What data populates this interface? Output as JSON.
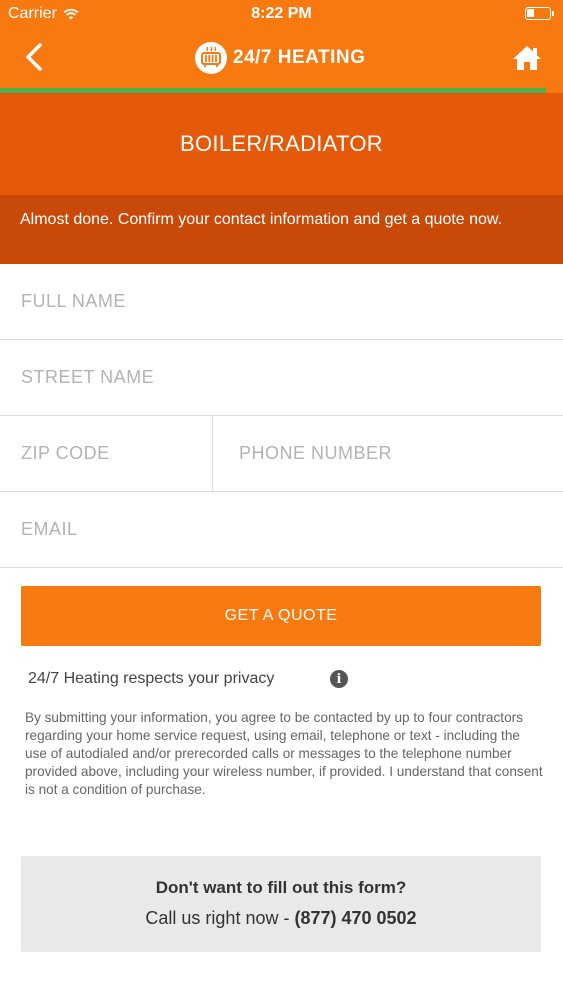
{
  "status_bar": {
    "carrier": "Carrier",
    "time": "8:22 PM"
  },
  "nav": {
    "brand": "24/7 HEATING",
    "back_icon": "chevron-left-icon",
    "home_icon": "home-icon"
  },
  "progress": {
    "fraction": 0.97,
    "color": "#4caf50"
  },
  "section": {
    "title": "BOILER/RADIATOR"
  },
  "notice": {
    "text": "Almost done. Confirm your contact information and get a quote now."
  },
  "form": {
    "full_name": {
      "placeholder": "FULL NAME",
      "value": ""
    },
    "street_name": {
      "placeholder": "STREET NAME",
      "value": ""
    },
    "zip_code": {
      "placeholder": "ZIP CODE",
      "value": ""
    },
    "phone_number": {
      "placeholder": "PHONE NUMBER",
      "value": ""
    },
    "email": {
      "placeholder": "EMAIL",
      "value": ""
    },
    "submit_label": "GET A QUOTE"
  },
  "privacy": {
    "label": "24/7 Heating respects your privacy",
    "info_icon": "info-icon",
    "consent": "By submitting your information, you agree to be contacted by up to four contractors regarding your home service request, using email, telephone or text - including the use of autodialed and/or prerecorded calls or messages to the telephone number provided above, including your wireless number, if provided. I understand that consent is not a condition of purchase."
  },
  "call": {
    "heading": "Don't want to fill out this form?",
    "prefix": "Call us right now - ",
    "phone": "(877) 470 0502"
  },
  "colors": {
    "brand_orange": "#f7790f",
    "header_orange": "#e55a0a",
    "notice_orange": "#c94a08",
    "call_box": "#e9e9e9"
  }
}
